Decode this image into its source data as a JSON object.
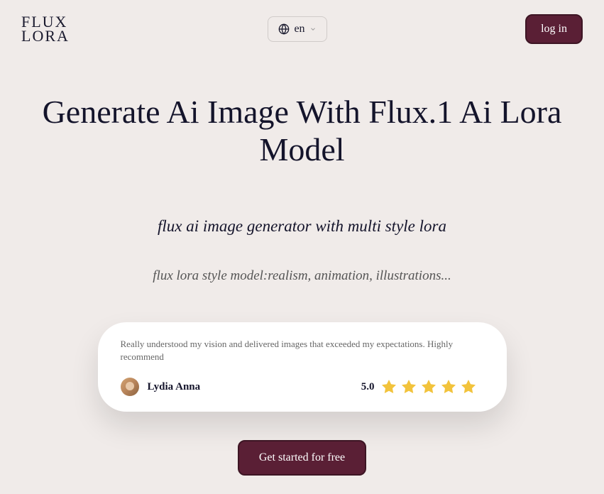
{
  "header": {
    "logo_line1": "FLUX",
    "logo_line2": "LORA",
    "lang": "en",
    "login_label": "log in"
  },
  "hero": {
    "title": "Generate Ai Image With Flux.1 Ai Lora Model",
    "subtitle": "flux ai image generator with multi style lora",
    "subtitle2": "flux lora style model:realism, animation, illustrations..."
  },
  "review": {
    "text": "Really understood my vision and delivered images that exceeded my expectations. Highly recommend",
    "reviewer_name": "Lydia Anna",
    "rating": "5.0"
  },
  "cta": {
    "label": "Get started for free"
  }
}
